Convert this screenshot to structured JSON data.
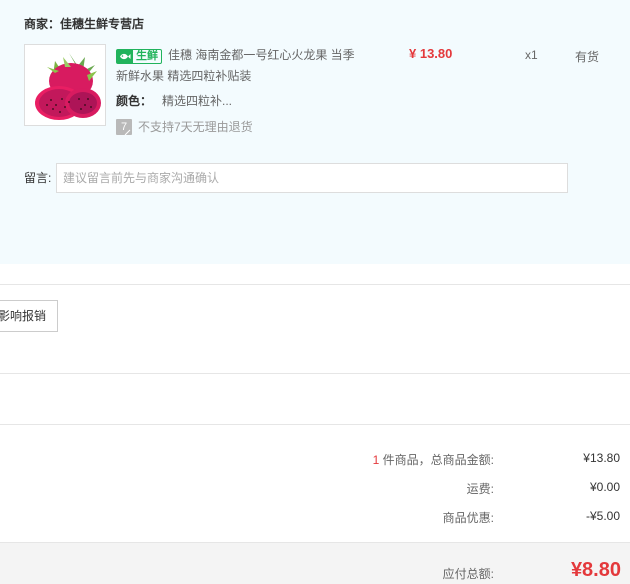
{
  "order": {
    "merchant_label": "商家：",
    "merchant_name": "佳穗生鲜专营店",
    "item": {
      "tag_label": "生鲜",
      "title": "佳穗 海南金都一号红心火龙果 当季新鲜水果 精选四粒补贴装",
      "price": "¥ 13.80",
      "quantity": "x1",
      "stock": "有货",
      "attr_key": "颜色：",
      "attr_value": "精选四粒补...",
      "return_badge": "7",
      "return_policy": "不支持7天无理由退货"
    },
    "note_label": "留言:",
    "note_placeholder": "建议留言前先与商家沟通确认"
  },
  "invoice": {
    "button_label": "影响报销"
  },
  "summary": {
    "item_count": "1",
    "item_count_suffix": " 件商品，总商品金额:",
    "goods_total": "¥13.80",
    "shipping_label": "运费:",
    "shipping_value": "¥0.00",
    "discount_label": "商品优惠:",
    "discount_value": "-¥5.00",
    "payable_label": "应付总额:",
    "payable_value": "¥8.80"
  },
  "colors": {
    "accent_red": "#e4393c",
    "fresh_green": "#21b35c",
    "panel_bg": "#f3fbfe"
  }
}
